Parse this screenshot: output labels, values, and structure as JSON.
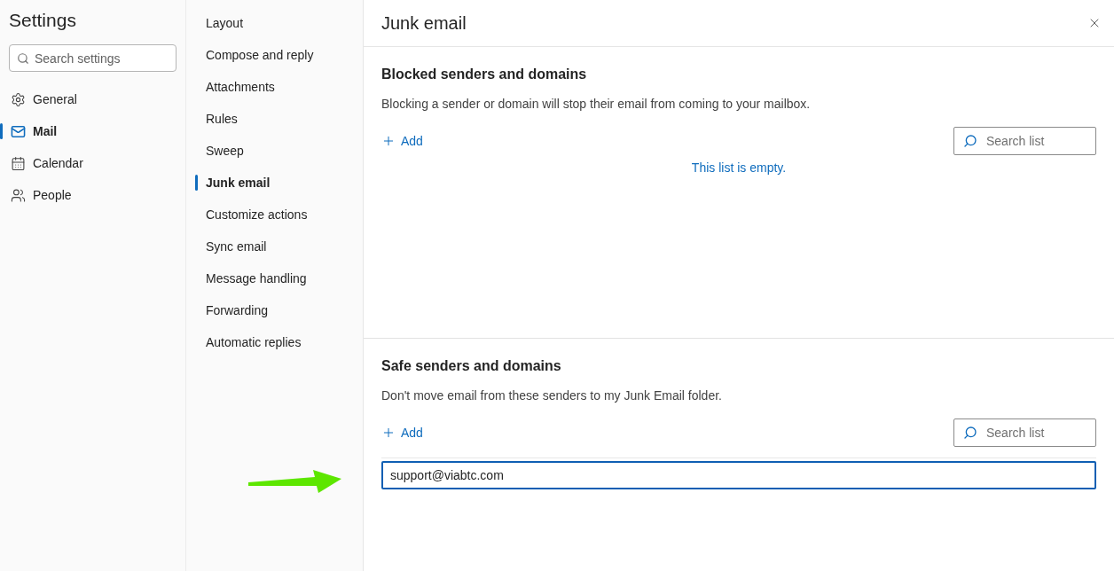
{
  "sidebar": {
    "title": "Settings",
    "search": {
      "placeholder": "Search settings"
    },
    "items": [
      {
        "label": "General",
        "kind": "general",
        "selected": false
      },
      {
        "label": "Mail",
        "kind": "mail",
        "selected": true
      },
      {
        "label": "Calendar",
        "kind": "calendar",
        "selected": false
      },
      {
        "label": "People",
        "kind": "people",
        "selected": false
      }
    ]
  },
  "submenu": {
    "items": [
      {
        "label": "Layout",
        "selected": false
      },
      {
        "label": "Compose and reply",
        "selected": false
      },
      {
        "label": "Attachments",
        "selected": false
      },
      {
        "label": "Rules",
        "selected": false
      },
      {
        "label": "Sweep",
        "selected": false
      },
      {
        "label": "Junk email",
        "selected": true
      },
      {
        "label": "Customize actions",
        "selected": false
      },
      {
        "label": "Sync email",
        "selected": false
      },
      {
        "label": "Message handling",
        "selected": false
      },
      {
        "label": "Forwarding",
        "selected": false
      },
      {
        "label": "Automatic replies",
        "selected": false
      }
    ]
  },
  "panel": {
    "title": "Junk email",
    "sections": [
      {
        "title": "Blocked senders and domains",
        "description": "Blocking a sender or domain will stop their email from coming to your mailbox.",
        "add_label": "Add",
        "search": {
          "placeholder": "Search list"
        },
        "empty_message": "This list is empty."
      },
      {
        "title": "Safe senders and domains",
        "description": "Don't move email from these senders to my Junk Email folder.",
        "add_label": "Add",
        "search": {
          "placeholder": "Search list"
        },
        "input": {
          "value": "support@viabtc.com"
        }
      }
    ]
  },
  "annotation": {
    "kind": "arrow"
  }
}
